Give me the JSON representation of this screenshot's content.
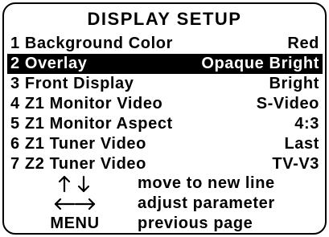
{
  "title": "DISPLAY SETUP",
  "items": [
    {
      "num": "1",
      "label": "Background Color",
      "value": "Red",
      "selected": false
    },
    {
      "num": "2",
      "label": "Overlay",
      "value": "Opaque Bright",
      "selected": true
    },
    {
      "num": "3",
      "label": "Front Display",
      "value": "Bright",
      "selected": false
    },
    {
      "num": "4",
      "label": "Z1 Monitor Video",
      "value": "S-Video",
      "selected": false
    },
    {
      "num": "5",
      "label": "Z1 Monitor Aspect",
      "value": "4:3",
      "selected": false
    },
    {
      "num": "6",
      "label": "Z1 Tuner Video",
      "value": "Last",
      "selected": false
    },
    {
      "num": "7",
      "label": "Z2 Tuner Video",
      "value": "TV-V3",
      "selected": false
    }
  ],
  "help": [
    {
      "key_icon": "up-down-arrows-icon",
      "key_glyph": "↑ ↓",
      "text": "move to new line"
    },
    {
      "key_icon": "left-right-arrows-icon",
      "key_glyph": "←→",
      "text": "adjust parameter"
    },
    {
      "key_icon": "",
      "key_glyph": "MENU",
      "text": "previous page"
    }
  ]
}
